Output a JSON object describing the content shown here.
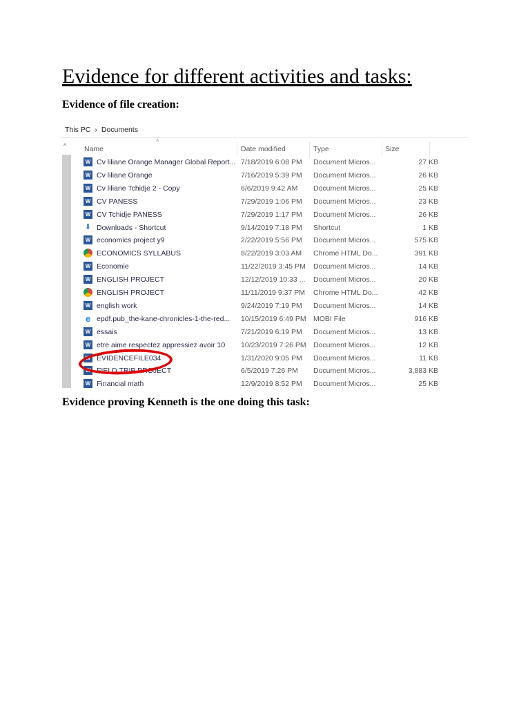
{
  "heading": "Evidence for different activities and tasks:",
  "section1": "Evidence of file creation:",
  "section2": "Evidence proving Kenneth is the one doing this task:",
  "explorer": {
    "breadcrumb": [
      "This PC",
      "›",
      "Documents"
    ],
    "columns": {
      "name": "Name",
      "date": "Date modified",
      "type": "Type",
      "size": "Size"
    },
    "rows": [
      {
        "icon": "word",
        "name": "Cv liliane Orange Manager Global Report...",
        "date": "7/18/2019 6:08 PM",
        "type": "Document Micros...",
        "size": "27 KB"
      },
      {
        "icon": "word",
        "name": "Cv liliane Orange",
        "date": "7/16/2019 5:39 PM",
        "type": "Document Micros...",
        "size": "26 KB"
      },
      {
        "icon": "word",
        "name": "Cv liliane Tchidje 2 - Copy",
        "date": "6/6/2019 9:42 AM",
        "type": "Document Micros...",
        "size": "25 KB"
      },
      {
        "icon": "word",
        "name": "CV PANESS",
        "date": "7/29/2019 1:06 PM",
        "type": "Document Micros...",
        "size": "23 KB"
      },
      {
        "icon": "word",
        "name": "CV Tchidje PANESS",
        "date": "7/29/2019 1:17 PM",
        "type": "Document Micros...",
        "size": "26 KB"
      },
      {
        "icon": "shortcut",
        "name": "Downloads - Shortcut",
        "date": "9/14/2019 7:18 PM",
        "type": "Shortcut",
        "size": "1 KB"
      },
      {
        "icon": "word",
        "name": "economics project y9",
        "date": "2/22/2019 5:56 PM",
        "type": "Document Micros...",
        "size": "575 KB"
      },
      {
        "icon": "chrome",
        "name": "ECONOMICS SYLLABUS",
        "date": "8/22/2019 3:03 AM",
        "type": "Chrome HTML Do...",
        "size": "391 KB"
      },
      {
        "icon": "word",
        "name": "Economie",
        "date": "11/22/2019 3:45 PM",
        "type": "Document Micros...",
        "size": "14 KB"
      },
      {
        "icon": "word",
        "name": "ENGLISH PROJECT",
        "date": "12/12/2019 10:33 ...",
        "type": "Document Micros...",
        "size": "20 KB"
      },
      {
        "icon": "chrome",
        "name": "ENGLISH PROJECT",
        "date": "11/11/2019 9:37 PM",
        "type": "Chrome HTML Do...",
        "size": "42 KB"
      },
      {
        "icon": "word",
        "name": "english work",
        "date": "9/24/2019 7:19 PM",
        "type": "Document Micros...",
        "size": "14 KB"
      },
      {
        "icon": "ie",
        "name": "epdf.pub_the-kane-chronicles-1-the-red...",
        "date": "10/15/2019 6:49 PM",
        "type": "MOBI File",
        "size": "916 KB"
      },
      {
        "icon": "word",
        "name": "essais",
        "date": "7/21/2019 6:19 PM",
        "type": "Document Micros...",
        "size": "13 KB"
      },
      {
        "icon": "word",
        "name": "etre aime respectez appressiez avoir 10",
        "date": "10/23/2019 7:26 PM",
        "type": "Document Micros...",
        "size": "12 KB"
      },
      {
        "icon": "word",
        "name": "EVIDENCEFILE034",
        "date": "1/31/2020 9:05 PM",
        "type": "Document Micros...",
        "size": "11 KB"
      },
      {
        "icon": "word",
        "name": "FIELD TRIP PROJECT",
        "date": "6/5/2019 7:26 PM",
        "type": "Document Micros...",
        "size": "3,883 KB"
      },
      {
        "icon": "word",
        "name": "Financial math",
        "date": "12/9/2019 8:52 PM",
        "type": "Document Micros...",
        "size": "25 KB"
      }
    ]
  },
  "highlight_color": "#e00000"
}
